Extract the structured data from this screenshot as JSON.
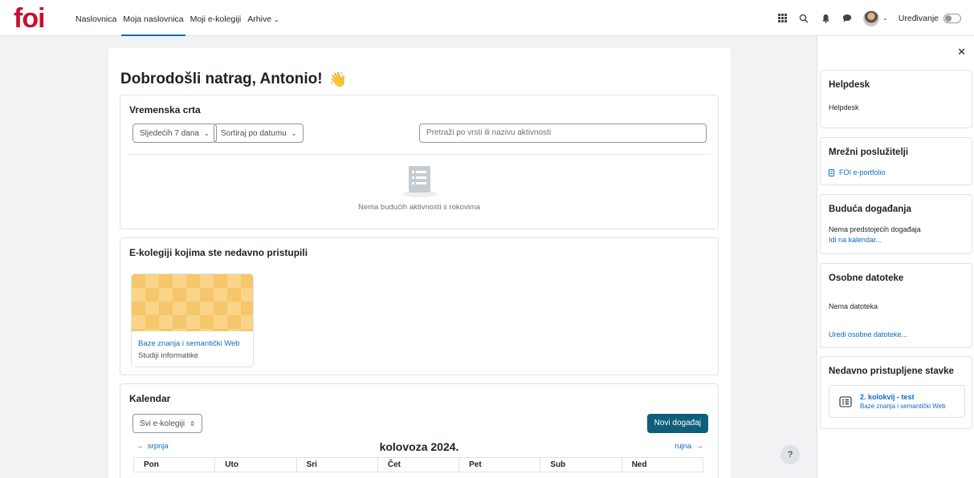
{
  "brand": {
    "logo_text": "foi",
    "logo_color": "#c8102e"
  },
  "nav": {
    "items": [
      {
        "label": "Naslovnica"
      },
      {
        "label": "Moja naslovnica"
      },
      {
        "label": "Moji e-kolegiji"
      },
      {
        "label": "Arhive"
      }
    ],
    "active": "Moja naslovnica",
    "edit_mode_label": "Uređivanje",
    "icons": [
      "grid-icon",
      "search-icon",
      "bell-icon",
      "chat-icon",
      "avatar",
      "chevron-down-icon"
    ]
  },
  "welcome": {
    "text": "Dobrodošli natrag, Antonio!",
    "emoji": "👋"
  },
  "timeline": {
    "title": "Vremenska crta",
    "filter_days": "Sljedećih 7 dana",
    "sort": "Sortiraj po datumu",
    "search_placeholder": "Pretraži po vrsti ili nazivu aktivnosti",
    "empty_text": "Nema budućih aktivnosti s rokovima"
  },
  "recent_courses": {
    "title": "E-kolegiji kojima ste nedavno pristupili",
    "courses": [
      {
        "name": "Baze znanja i semantički Web",
        "category": "Studiji informatike"
      }
    ]
  },
  "calendar": {
    "title": "Kalendar",
    "course_filter": "Svi e-kolegiji",
    "new_event_label": "Novi događaj",
    "prev_month": "srpnja",
    "next_month": "rujna",
    "month": "kolovoza 2024.",
    "weekdays": [
      "Pon",
      "Uto",
      "Sri",
      "Čet",
      "Pet",
      "Sub",
      "Ned"
    ]
  },
  "drawer": {
    "blocks": {
      "helpdesk": {
        "title": "Helpdesk",
        "text": "Helpdesk"
      },
      "servers": {
        "title": "Mrežni poslužitelji",
        "link": "FOI e-portfolio"
      },
      "events": {
        "title": "Buduća događanja",
        "text": "Nema predstojećih događaja",
        "link": "Idi na kalendar..."
      },
      "files": {
        "title": "Osobne datoteke",
        "text": "Nema datoteka",
        "link": "Uredi osobne datoteke..."
      },
      "recent_items": {
        "title": "Nedavno pristupljene stavke",
        "item_title": "2. kolokvij - test",
        "item_course": "Baze znanja i semantički Web"
      }
    }
  },
  "help_label": "?",
  "colors": {
    "accent": "#0f6cbf",
    "primary_button": "#0f5f7a",
    "background": "#f1f2f3"
  }
}
